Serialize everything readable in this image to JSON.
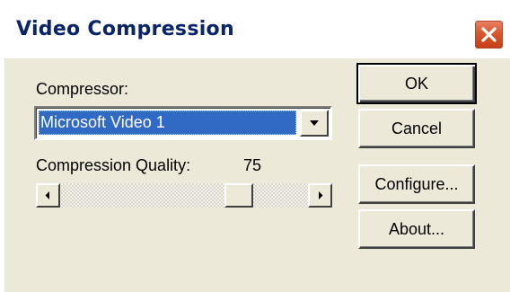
{
  "window": {
    "title": "Video Compression",
    "close_icon": "close-icon"
  },
  "compressor": {
    "label": "Compressor:",
    "selected": "Microsoft Video 1",
    "dropdown_icon": "chevron-down-icon"
  },
  "quality": {
    "label": "Compression Quality:",
    "value": "75",
    "slider_fraction": 0.75
  },
  "buttons": {
    "ok": "OK",
    "cancel": "Cancel",
    "configure": "Configure...",
    "about": "About..."
  },
  "colors": {
    "selection": "#316ac5",
    "dialog_face": "#ece9d8",
    "title_text": "#0a246a",
    "close_button": "#d8572f"
  }
}
